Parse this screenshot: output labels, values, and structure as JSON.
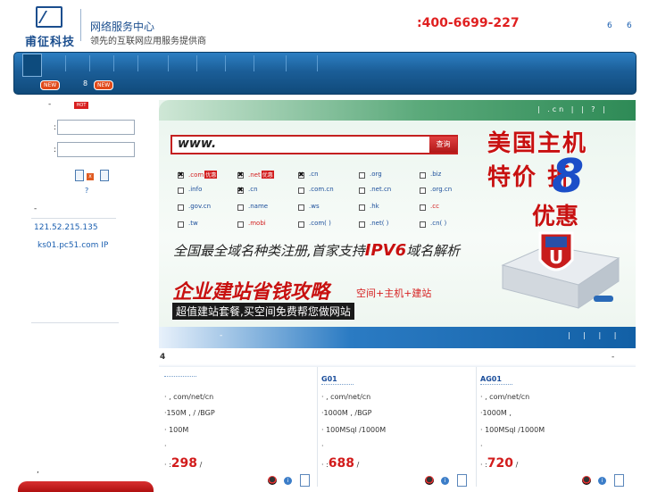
{
  "header": {
    "logo_text": "甫征科技",
    "title": "网络服务中心",
    "slogan": "领先的互联网应用服务提供商",
    "hotline": ":400-6699-227",
    "top_links": [
      "6",
      "6"
    ]
  },
  "nav": {
    "sub_badge_1": "NEW",
    "sub_text": "8",
    "sub_badge_2": "NEW"
  },
  "sidebar": {
    "login_title": "-",
    "hot_badge": "HOT",
    "field_1_label": ":",
    "field_1_value": "",
    "field_2_label": ":",
    "field_2_value": "",
    "login_x": "x",
    "forgot": "?",
    "section_title": "-",
    "dns_ip": "121.52.215.135",
    "dns_host": "ks01.pc51.com  IP",
    "bottom_text": ","
  },
  "banner": {
    "top_links": "| .cn | | ? |",
    "domain_prefix": "www.",
    "search_label": "查询",
    "checkbox_rows": [
      [
        {
          "label": ".com",
          "hot": "优惠",
          "checked": true,
          "red": true
        },
        {
          "label": ".net",
          "hot": "优惠",
          "checked": true,
          "red": true
        },
        {
          "label": ".cn",
          "checked": true
        },
        {
          "label": ".org"
        },
        {
          "label": ".biz"
        }
      ],
      [
        {
          "label": ".info"
        },
        {
          "label": ".cn",
          "checked": true
        },
        {
          "label": ".com.cn"
        },
        {
          "label": ".net.cn"
        },
        {
          "label": ".org.cn"
        }
      ],
      [
        {
          "label": ".gov.cn"
        },
        {
          "label": ".name"
        },
        {
          "label": ".ws"
        },
        {
          "label": ".hk"
        },
        {
          "label": ".cc",
          "red": true
        }
      ],
      [
        {
          "label": ".tw"
        },
        {
          "label": ".mobi",
          "red": true
        },
        {
          "label": ".com( )"
        },
        {
          "label": ".net( )"
        },
        {
          "label": ".cn( )"
        }
      ]
    ],
    "promo_line_1": "美国主机",
    "promo_line_2": "特价   折",
    "promo_digit": "8",
    "promo_line_3": "优惠",
    "ipv6_pre": "全国最全域名种类注册,首家支持",
    "ipv6_bold": "IPV6",
    "ipv6_post": "域名解析",
    "site_title": "企业建站省钱攻略",
    "site_sub": "空间+主机+建站",
    "site_slogan": "超值建站套餐,买空间免费帮您做网站",
    "bottom_dash": "-",
    "bottom_links": "| | | |"
  },
  "products": {
    "title": "4",
    "more": "-",
    "columns": [
      {
        "name": "",
        "l1": "·    , com/net/cn",
        "l2": "·150M ,  / /BGP",
        "l3": "· 100M",
        "l4": "·",
        "price_pre": "· :",
        "price": "298",
        "price_post": "/"
      },
      {
        "name": "G01",
        "l1": "·    , com/net/cn",
        "l2": "·1000M ,  /BGP",
        "l3": "· 100MSql  /1000M",
        "l4": "·",
        "price_pre": "· :",
        "price": "688",
        "price_post": "/"
      },
      {
        "name": "AG01",
        "l1": "·    , com/net/cn",
        "l2": "·1000M ,",
        "l3": "· 100MSql  /1000M",
        "l4": "·",
        "price_pre": "· :",
        "price": "720",
        "price_post": "/"
      }
    ]
  }
}
